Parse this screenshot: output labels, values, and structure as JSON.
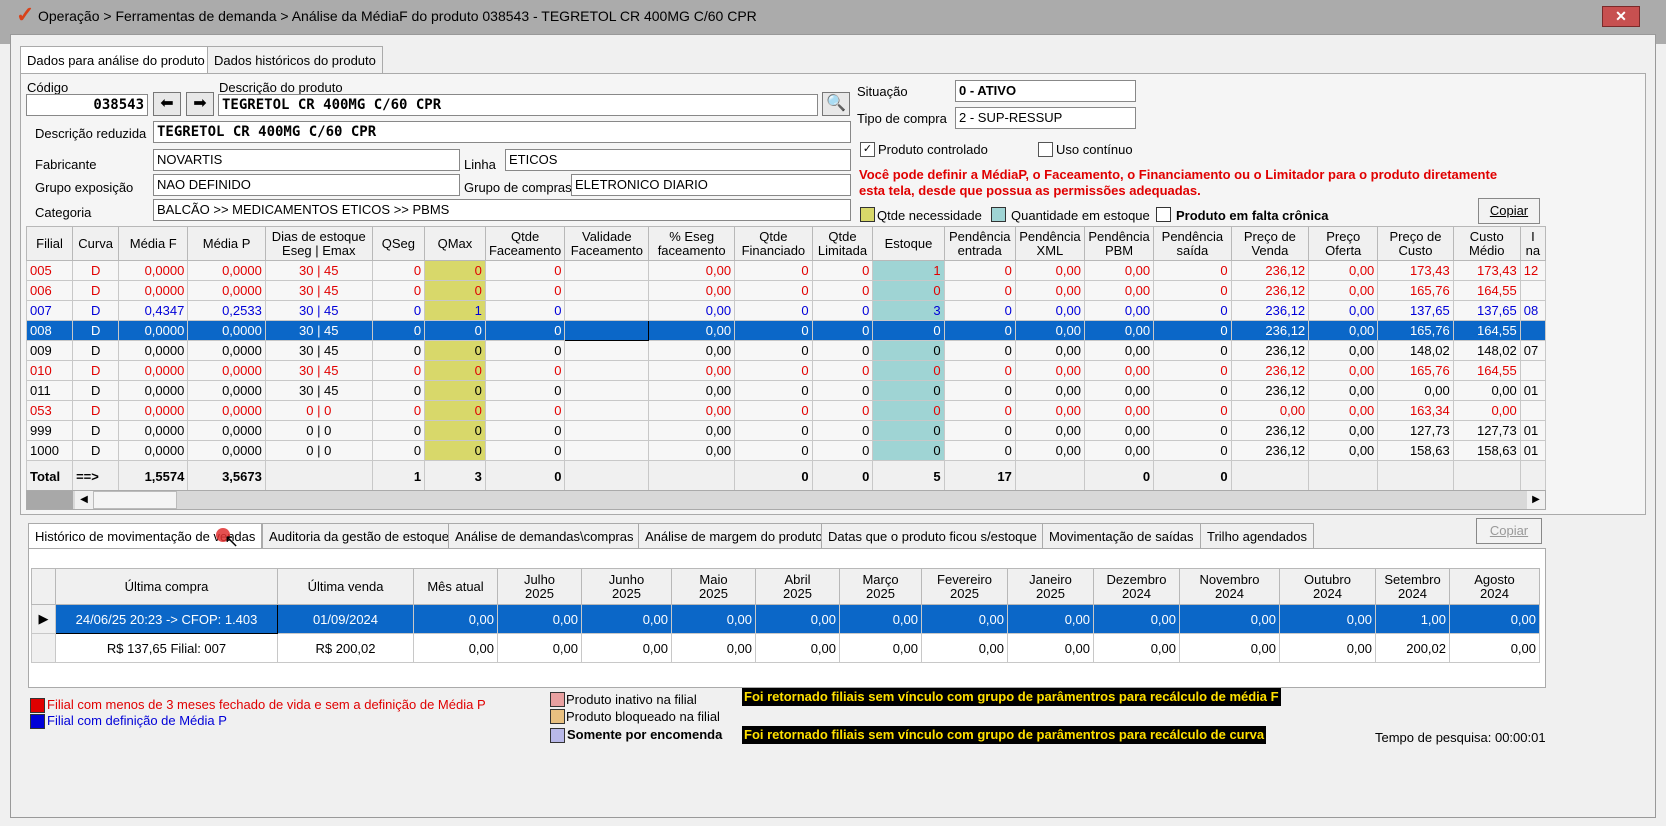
{
  "window": {
    "title": "Operação > Ferramentas de demanda > Análise da MédiaF do produto 038543 - TEGRETOL CR 400MG C/60 CPR",
    "close_label": "✕"
  },
  "top_tabs": [
    "Dados para análise do produto",
    "Dados históricos do produto"
  ],
  "form": {
    "codigo_label": "Código",
    "codigo_value": "038543",
    "descricao_label": "Descrição do produto",
    "descricao_value": "TEGRETOL CR 400MG C/60 CPR",
    "desc_reduzida_label": "Descrição reduzida",
    "desc_reduzida_value": "TEGRETOL CR 400MG C/60 CPR",
    "fabricante_label": "Fabricante",
    "fabricante_value": "NOVARTIS",
    "linha_label": "Linha",
    "linha_value": "ETICOS",
    "grupo_exp_label": "Grupo exposição",
    "grupo_exp_value": "NAO DEFINIDO",
    "grupo_compras_label": "Grupo de compras",
    "grupo_compras_value": "ELETRONICO DIARIO",
    "categoria_label": "Categoria",
    "categoria_value": "BALCÃO >> MEDICAMENTOS ETICOS >> PBMS",
    "situacao_label": "Situação",
    "situacao_value": "0 - ATIVO",
    "tipo_compra_label": "Tipo de compra",
    "tipo_compra_value": "2 - SUP-RESSUP",
    "produto_controlado_label": "Produto controlado",
    "uso_continuo_label": "Uso contínuo",
    "warning_line1": "Você pode definir a MédiaP, o Faceamento, o Financiamento ou o Limitador para o produto diretamente",
    "warning_line2": "esta tela, desde que possua as permissões adequadas.",
    "legend_qtde": "Qtde necessidade",
    "legend_estoque": "Quantidade em estoque",
    "legend_falta": "Produto em falta crônica",
    "copiar": "Copiar"
  },
  "grid": {
    "headers": [
      "Filial",
      "Curva",
      "Média F",
      "Média P",
      "Dias de estoque\nEseg | Emax",
      "QSeg",
      "QMax",
      "Qtde\nFaceamento",
      "Validade\nFaceamento",
      "% Eseg\nfaceamento",
      "Qtde\nFinanciado",
      "Qtde\nLimitada",
      "Estoque",
      "Pendência\nentrada",
      "Pendência\nXML",
      "Pendência\nPBM",
      "Pendência\nsaída",
      "Preço de\nVenda",
      "Preço\nOferta",
      "Preço de\nCusto",
      "Custo\nMédio",
      "I\nna"
    ],
    "rows": [
      {
        "style": "red",
        "cells": [
          "005",
          "D",
          "0,0000",
          "0,0000",
          "30  |  45",
          "0",
          "0",
          "0",
          "",
          "0,00",
          "0",
          "0",
          "1",
          "0",
          "0,00",
          "0,00",
          "0",
          "236,12",
          "0,00",
          "173,43",
          "173,43",
          "12"
        ]
      },
      {
        "style": "red",
        "cells": [
          "006",
          "D",
          "0,0000",
          "0,0000",
          "30  |  45",
          "0",
          "0",
          "0",
          "",
          "0,00",
          "0",
          "0",
          "0",
          "0",
          "0,00",
          "0,00",
          "0",
          "236,12",
          "0,00",
          "165,76",
          "164,55",
          ""
        ]
      },
      {
        "style": "blue",
        "cells": [
          "007",
          "D",
          "0,4347",
          "0,2533",
          "30  |  45",
          "0",
          "1",
          "0",
          "",
          "0,00",
          "0",
          "0",
          "3",
          "0",
          "0,00",
          "0,00",
          "0",
          "236,12",
          "0,00",
          "137,65",
          "137,65",
          "08"
        ]
      },
      {
        "style": "sel",
        "cells": [
          "008",
          "D",
          "0,0000",
          "0,0000",
          "30  |  45",
          "0",
          "0",
          "0",
          "",
          "0,00",
          "0",
          "0",
          "0",
          "0",
          "0,00",
          "0,00",
          "0",
          "236,12",
          "0,00",
          "165,76",
          "164,55",
          ""
        ]
      },
      {
        "style": "",
        "cells": [
          "009",
          "D",
          "0,0000",
          "0,0000",
          "30  |  45",
          "0",
          "0",
          "0",
          "",
          "0,00",
          "0",
          "0",
          "0",
          "0",
          "0,00",
          "0,00",
          "0",
          "236,12",
          "0,00",
          "148,02",
          "148,02",
          "07"
        ]
      },
      {
        "style": "red",
        "cells": [
          "010",
          "D",
          "0,0000",
          "0,0000",
          "30  |  45",
          "0",
          "0",
          "0",
          "",
          "0,00",
          "0",
          "0",
          "0",
          "0",
          "0,00",
          "0,00",
          "0",
          "236,12",
          "0,00",
          "165,76",
          "164,55",
          ""
        ]
      },
      {
        "style": "",
        "cells": [
          "011",
          "D",
          "0,0000",
          "0,0000",
          "30  |  45",
          "0",
          "0",
          "0",
          "",
          "0,00",
          "0",
          "0",
          "0",
          "0",
          "0,00",
          "0,00",
          "0",
          "236,12",
          "0,00",
          "0,00",
          "0,00",
          "01"
        ]
      },
      {
        "style": "red",
        "cells": [
          "053",
          "D",
          "0,0000",
          "0,0000",
          "0  |  0",
          "0",
          "0",
          "0",
          "",
          "0,00",
          "0",
          "0",
          "0",
          "0",
          "0,00",
          "0,00",
          "0",
          "0,00",
          "0,00",
          "163,34",
          "0,00",
          ""
        ]
      },
      {
        "style": "",
        "cells": [
          "999",
          "D",
          "0,0000",
          "0,0000",
          "0  |  0",
          "0",
          "0",
          "0",
          "",
          "0,00",
          "0",
          "0",
          "0",
          "0",
          "0,00",
          "0,00",
          "0",
          "236,12",
          "0,00",
          "127,73",
          "127,73",
          "01"
        ]
      },
      {
        "style": "",
        "cells": [
          "1000",
          "D",
          "0,0000",
          "0,0000",
          "0  |  0",
          "0",
          "0",
          "0",
          "",
          "0,00",
          "0",
          "0",
          "0",
          "0",
          "0,00",
          "0,00",
          "0",
          "236,12",
          "0,00",
          "158,63",
          "158,63",
          "01"
        ]
      }
    ],
    "total": [
      "Total",
      "==>",
      "1,5574",
      "3,5673",
      "",
      "1",
      "3",
      "0",
      "",
      "",
      "0",
      "0",
      "5",
      "17",
      "",
      "0",
      "0",
      "",
      "",
      "",
      "",
      ""
    ]
  },
  "bottom_tabs": [
    "Histórico de movimentação de vendas",
    "Auditoria da gestão de estoque",
    "Análise de demandas\\compras",
    "Análise de margem do produto",
    "Datas que o produto ficou s/estoque",
    "Movimentação de saídas",
    "Trilho agendados"
  ],
  "bottom_copiar": "Copiar",
  "history": {
    "headers": [
      "Última compra",
      "Última venda",
      "Mês atual",
      "Julho\n2025",
      "Junho\n2025",
      "Maio\n2025",
      "Abril\n2025",
      "Março\n2025",
      "Fevereiro\n2025",
      "Janeiro\n2025",
      "Dezembro\n2024",
      "Novembro\n2024",
      "Outubro\n2024",
      "Setembro\n2024",
      "Agosto\n2024"
    ],
    "rows": [
      {
        "sel": true,
        "marker": "▶",
        "cells": [
          "24/06/25 20:23 -> CFOP: 1.403",
          "01/09/2024",
          "0,00",
          "0,00",
          "0,00",
          "0,00",
          "0,00",
          "0,00",
          "0,00",
          "0,00",
          "0,00",
          "0,00",
          "0,00",
          "1,00",
          "0,00"
        ]
      },
      {
        "sel": false,
        "marker": "",
        "cells": [
          "R$ 137,65 Filial: 007",
          "R$ 200,02",
          "0,00",
          "0,00",
          "0,00",
          "0,00",
          "0,00",
          "0,00",
          "0,00",
          "0,00",
          "0,00",
          "0,00",
          "0,00",
          "200,02",
          "0,00"
        ]
      }
    ]
  },
  "footer": {
    "leg1": "Filial com menos de 3 meses fechado de vida e sem a definição de Média P",
    "leg2": "Filial com definição de Média P",
    "leg3": "Produto inativo na filial",
    "leg4": "Produto bloqueado na filial",
    "leg5": "Somente por encomenda",
    "banner1": "Foi retornado filiais sem vínculo com grupo de parâmentros para recálculo de média F",
    "banner2": "Foi retornado filiais sem vínculo com grupo de parâmentros para recálculo de curva",
    "tempo": "Tempo de pesquisa: 00:00:01"
  },
  "colors": {
    "accent": "#0b67c8",
    "red": "#e00000",
    "blue": "#0000d8",
    "yellow": "#d8d86a",
    "cyan": "#9fd4d4"
  }
}
